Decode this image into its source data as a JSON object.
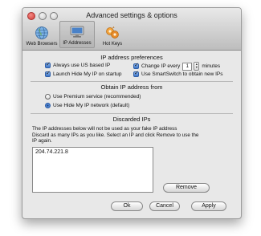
{
  "window": {
    "title": "Advanced settings & options"
  },
  "toolbar": {
    "items": [
      {
        "label": "Web Browsers",
        "icon": "web-browsers-icon"
      },
      {
        "label": "IP Addresses",
        "icon": "ip-addresses-icon"
      },
      {
        "label": "Hot Keys",
        "icon": "hot-keys-icon"
      }
    ],
    "active": "IP Addresses"
  },
  "ip_prefs": {
    "title": "IP address preferences",
    "always_us": {
      "label": "Always use US based IP",
      "checked": true
    },
    "change_ip_prefix": "Change IP every",
    "change_ip_checked": true,
    "change_ip_value": "1",
    "change_ip_suffix": "minutes",
    "launch_startup": {
      "label": "Launch Hide My IP on startup",
      "checked": true
    },
    "smartswitch": {
      "label": "Use SmartSwitch to obtain new IPs",
      "checked": true
    }
  },
  "obtain": {
    "title": "Obtain IP address from",
    "premium": {
      "label": "Use Premium service (recommended)",
      "selected": false
    },
    "network": {
      "label": "Use Hide My IP network (default)",
      "selected": true
    }
  },
  "discarded": {
    "title": "Discarded IPs",
    "description_1": "The IP addresses below will not be used as your fake IP address",
    "description_2": "Discard as many IPs as you like. Select an IP and click Remove to use the",
    "description_3": "IP again.",
    "ips": [
      "204.74.221.8"
    ],
    "remove_label": "Remove"
  },
  "buttons": {
    "ok": "Ok",
    "cancel": "Cancel",
    "apply": "Apply"
  }
}
